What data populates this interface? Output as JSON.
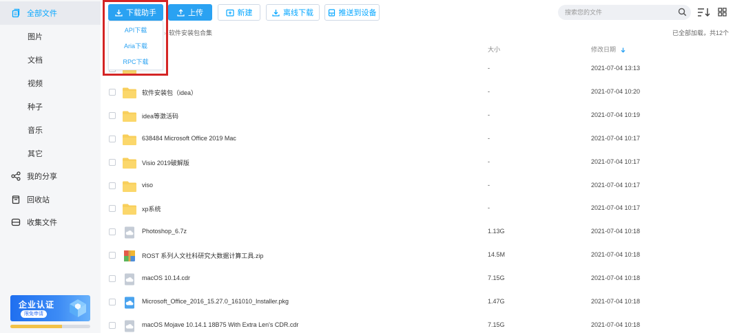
{
  "sidebar": {
    "items": [
      {
        "label": "全部文件",
        "icon": "files-icon",
        "active": true
      },
      {
        "label": "图片"
      },
      {
        "label": "文档"
      },
      {
        "label": "视频"
      },
      {
        "label": "种子"
      },
      {
        "label": "音乐"
      },
      {
        "label": "其它"
      },
      {
        "label": "我的分享",
        "icon": "share-icon"
      },
      {
        "label": "回收站",
        "icon": "trash-icon"
      },
      {
        "label": "收集文件",
        "icon": "collect-icon"
      }
    ],
    "enterprise": {
      "title": "企业认证",
      "button": "限免申请",
      "progress": 0.65
    }
  },
  "toolbar": {
    "download_helper": "下载助手",
    "upload": "上传",
    "new": "新建",
    "offline_download": "离线下载",
    "push_to_device": "推送到设备",
    "search_placeholder": "搜索您的文件"
  },
  "dropdown": {
    "items": [
      "API下载",
      "Aria下载",
      "RPC下载"
    ]
  },
  "breadcrumb": {
    "prefix": "件",
    "current": "软件安装包合集"
  },
  "status": "已全部加载，共12个",
  "columns": {
    "size": "大小",
    "modified": "修改日期"
  },
  "files": [
    {
      "name": "",
      "size": "-",
      "date": "2021-07-04 13:13",
      "type": "folder"
    },
    {
      "name": "软件安装包（idea）",
      "size": "-",
      "date": "2021-07-04 10:20",
      "type": "folder"
    },
    {
      "name": "idea等激活码",
      "size": "-",
      "date": "2021-07-04 10:19",
      "type": "folder"
    },
    {
      "name": "638484 Microsoft Office 2019 Mac",
      "size": "-",
      "date": "2021-07-04 10:17",
      "type": "folder"
    },
    {
      "name": "Visio 2019破解版",
      "size": "-",
      "date": "2021-07-04 10:17",
      "type": "folder"
    },
    {
      "name": "viso",
      "size": "-",
      "date": "2021-07-04 10:17",
      "type": "folder"
    },
    {
      "name": "xp系统",
      "size": "-",
      "date": "2021-07-04 10:17",
      "type": "folder"
    },
    {
      "name": "Photoshop_6.7z",
      "size": "1.13G",
      "date": "2021-07-04 10:18",
      "type": "cloud"
    },
    {
      "name": "ROST 系列人文社科研究大数据计算工具.zip",
      "size": "14.5M",
      "date": "2021-07-04 10:18",
      "type": "zip"
    },
    {
      "name": "macOS 10.14.cdr",
      "size": "7.15G",
      "date": "2021-07-04 10:18",
      "type": "cloud"
    },
    {
      "name": "Microsoft_Office_2016_15.27.0_161010_Installer.pkg",
      "size": "1.47G",
      "date": "2021-07-04 10:18",
      "type": "pkg"
    },
    {
      "name": "macOS Mojave 10.14.1 18B75 With Extra Len's CDR.cdr",
      "size": "7.15G",
      "date": "2021-07-04 10:18",
      "type": "cloud"
    }
  ],
  "colors": {
    "accent": "#06a7ff",
    "primary_button": "#2aa2f2",
    "highlight": "#d42424",
    "folder": "#f8cf5c"
  }
}
